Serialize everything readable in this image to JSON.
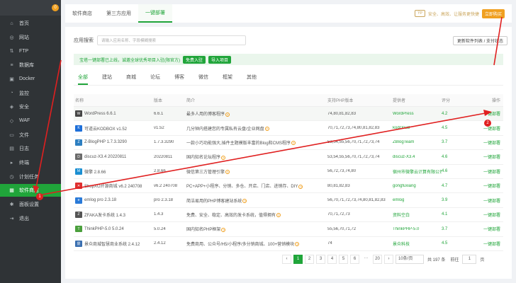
{
  "sidebar": {
    "header": "",
    "badge": "0",
    "items": [
      {
        "label": "首页",
        "icon": "home-icon",
        "glyph": "⌂"
      },
      {
        "label": "网站",
        "icon": "globe-icon",
        "glyph": "◎"
      },
      {
        "label": "FTP",
        "icon": "ftp-icon",
        "glyph": "⇅"
      },
      {
        "label": "数据库",
        "icon": "database-icon",
        "glyph": "≡"
      },
      {
        "label": "Docker",
        "icon": "docker-icon",
        "glyph": "▣"
      },
      {
        "label": "监控",
        "icon": "monitor-icon",
        "glyph": "◔"
      },
      {
        "label": "安全",
        "icon": "shield-icon",
        "glyph": "◈"
      },
      {
        "label": "WAF",
        "icon": "waf-icon",
        "glyph": "◇"
      },
      {
        "label": "文件",
        "icon": "folder-icon",
        "glyph": "▭"
      },
      {
        "label": "日志",
        "icon": "log-icon",
        "glyph": "▤"
      },
      {
        "label": "终端",
        "icon": "terminal-icon",
        "glyph": "▸"
      },
      {
        "label": "计划任务",
        "icon": "clock-icon",
        "glyph": "◷"
      },
      {
        "label": "软件商店",
        "icon": "store-icon",
        "glyph": "▦",
        "active": true
      },
      {
        "label": "面板设置",
        "icon": "gear-icon",
        "glyph": "✱"
      },
      {
        "label": "退出",
        "icon": "logout-icon",
        "glyph": "⇥"
      }
    ]
  },
  "topbar": {
    "tabs": [
      "软件商店",
      "第三方应用",
      "一键部署"
    ],
    "active_tab": 2,
    "vip_badge": "ŸP",
    "note": "安全、高效、让服务更快捷",
    "buy_label": "立即购买"
  },
  "search": {
    "label": "应用搜索",
    "placeholder": "请输入应用名称、字段模糊搜索"
  },
  "update_button": "更新软件列表 / 支付状态",
  "banner": {
    "text": "宝塔一键部署已上线，诚邀全球优秀项目入驻(限官方)",
    "btn1": "免费入驻",
    "btn2": "导入项目"
  },
  "categories": [
    "全部",
    "建站",
    "商城",
    "论坛",
    "博客",
    "微信",
    "框架",
    "其他"
  ],
  "table": {
    "headers": [
      "名称",
      "版本",
      "简介",
      "支持PHP版本",
      "提供者",
      "评分",
      "操作"
    ],
    "rows": [
      {
        "logo": "W",
        "logo_color": "#464646",
        "name": "WordPress 6.6.1",
        "ver": "6.6.1",
        "desc": "最多人用的博客程序",
        "php": "74,80,81,82,83",
        "provider": "WordPress",
        "score": "4.2",
        "action": "一键部署"
      },
      {
        "logo": "K",
        "logo_color": "#1e6fd9",
        "name": "可道云KODBOX v1.52",
        "ver": "v1.52",
        "desc": "几分钟内搭建您的专属私有云盘/企业网盘",
        "php": "70,71,72,73,74,80,81,82,83",
        "provider": "kodcloud",
        "score": "4.5",
        "action": "一键部署"
      },
      {
        "logo": "Z",
        "logo_color": "#2d7fc1",
        "name": "Z-BlogPHP 1.7.3.3290",
        "ver": "1.7.3.3290",
        "desc": "一款小巧功能强大,插件主题模版丰富的Blog和CMS程序",
        "php": "53,54,55,56,70,71,72,73,74",
        "provider": "ZBlogTeam",
        "score": "3.7",
        "action": "一键部署"
      },
      {
        "logo": "D",
        "logo_color": "#6b6b6b",
        "name": "discuz-X3.4 20220811",
        "ver": "20220811",
        "desc": "国内知名论坛程序",
        "php": "53,54,55,56,70,71,72,73,74",
        "provider": "discuz-X3.4",
        "score": "4.6",
        "action": "一键部署"
      },
      {
        "logo": "M",
        "logo_color": "#1b8fd2",
        "name": "微擎 2.8.66",
        "ver": "2.8.66",
        "desc": "微信第三方管理引擎",
        "php": "56,72,73,74,80",
        "provider": "宿州市微擎云计算有限公司",
        "score": "4.6",
        "action": "一键部署"
      },
      {
        "logo": "✕",
        "logo_color": "#e03030",
        "name": "ShopXO开源商城 v6.2 240708",
        "ver": "v6.2 240708",
        "desc": "PC+APP+小程序、分销、多仓、开店、门店、进销存、DIY",
        "php": "80,81,82,83",
        "provider": "gongfuxiang",
        "score": "4.7",
        "action": "一键部署"
      },
      {
        "logo": "e",
        "logo_color": "#2a7ad8",
        "name": "emlog pro 2.3.18",
        "ver": "pro 2.3.18",
        "desc": "简洁易用的PHP博客建站系统",
        "php": "56,70,71,72,73,74,80,81,82,83",
        "provider": "emlog",
        "score": "3.9",
        "action": "一键部署"
      },
      {
        "logo": "Z",
        "logo_color": "#555555",
        "name": "ZFAKA发卡系统 1.4.3",
        "ver": "1.4.3",
        "desc": "免费、安全、稳定、高效的发卡系统，值得拥有",
        "php": "70,71,72,73",
        "provider": "资料空白",
        "score": "4.1",
        "action": "一键部署"
      },
      {
        "logo": "T",
        "logo_color": "#4a9f3c",
        "name": "ThinkPHP-5.0 5.0.24",
        "ver": "5.0.24",
        "desc": "国内知名PHP框架",
        "php": "55,56,70,71,72",
        "provider": "ThinkPHP-5.0",
        "score": "3.7",
        "action": "一键部署"
      },
      {
        "logo": "景",
        "logo_color": "#3a6fb0",
        "name": "景众商城智慧商业系统 2.4.12",
        "ver": "2.4.12",
        "desc": "免费商用、公众号/H5/小程序/多分销商城、100+营销模块",
        "php": "74",
        "provider": "景众科技",
        "score": "4.5",
        "action": "一键部署"
      }
    ]
  },
  "pagination": {
    "prev": "‹",
    "pages": [
      "1",
      "2",
      "3",
      "4",
      "5",
      "6",
      "···",
      "20"
    ],
    "active": 0,
    "next": "›",
    "per_page": "10条/页",
    "total": "共 197 条",
    "goto_label": "前往",
    "goto_value": "1",
    "page_suffix": "页"
  },
  "annotations": {
    "marker1": "1",
    "marker2": "2",
    "color": "#e02020"
  }
}
